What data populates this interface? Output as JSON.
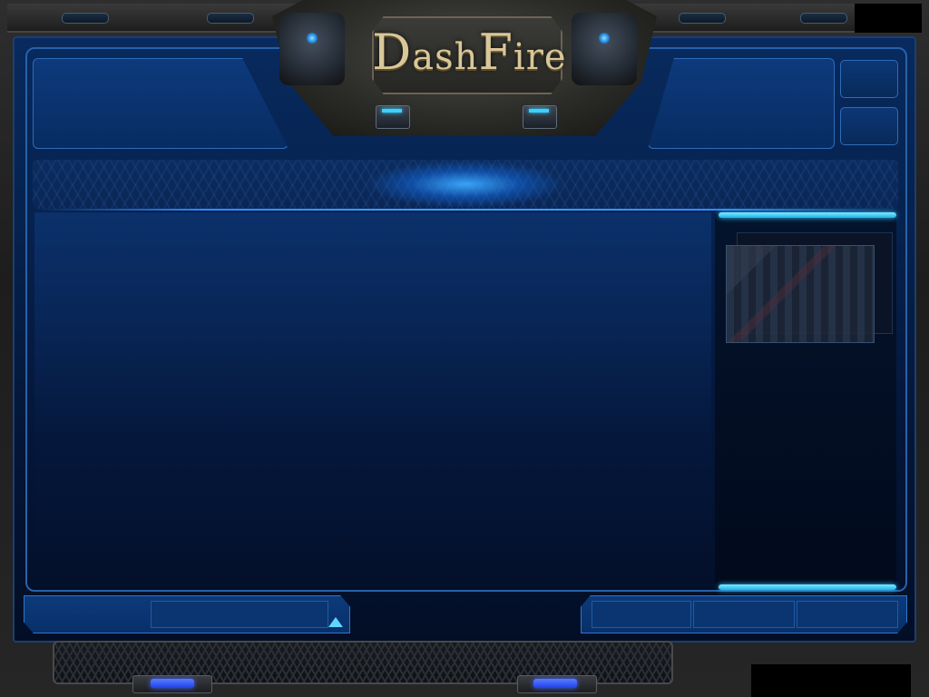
{
  "logo": {
    "part1_initial": "D",
    "part1_rest": "ash",
    "part2_initial": "F",
    "part2_rest": "ire"
  },
  "colors": {
    "panel_blue": "#06224e",
    "accent_cyan": "#3bd1ff",
    "border_blue": "#2762a8",
    "logo_gold": "#d9c79a"
  },
  "panels": {
    "top_left_header": "",
    "top_right_header": "",
    "side_button_1": "",
    "side_button_2": "",
    "main_content": "",
    "right_list": "",
    "bottom_left": "",
    "bottom_right_cells": [
      "",
      "",
      ""
    ]
  }
}
